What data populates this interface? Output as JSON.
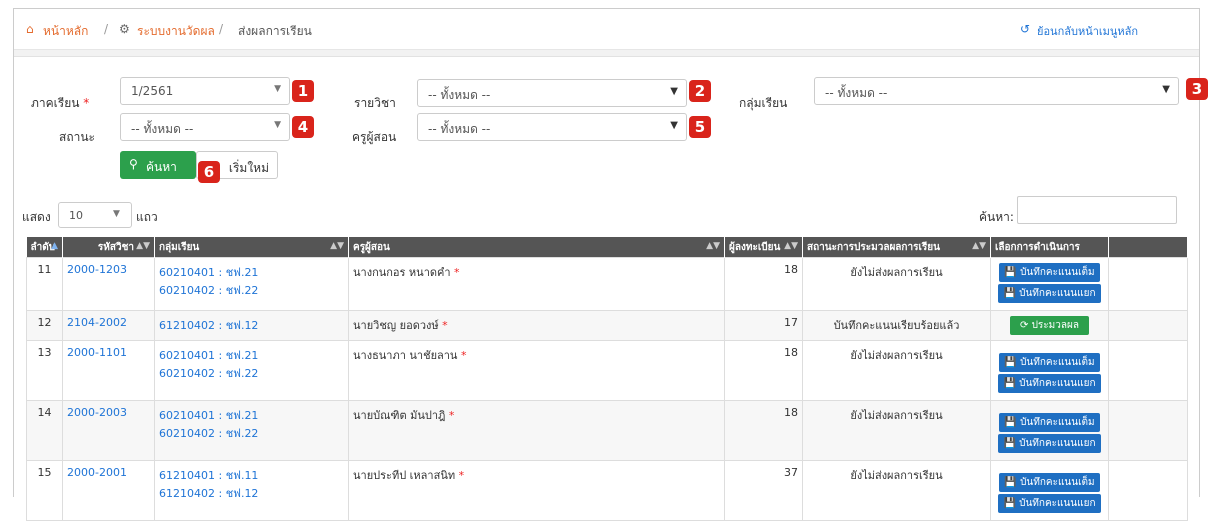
{
  "breadcrumb": {
    "home": "หน้าหลัก",
    "sep1": "/",
    "system": "ระบบงานวัดผล",
    "sep2": "/",
    "current": "ส่งผลการเรียน",
    "back": "ย้อนกลับหน้าเมนูหลัก"
  },
  "filters": {
    "semester_label": "ภาคเรียน",
    "required_mark": "*",
    "semester_value": "1/2561",
    "subject_label": "รายวิชา",
    "subject_value": "-- ทั้งหมด --",
    "group_label": "กลุ่มเรียน",
    "group_value": "-- ทั้งหมด --",
    "status_label": "สถานะ",
    "status_value": "-- ทั้งหมด --",
    "teacher_label": "ครูผู้สอน",
    "teacher_value": "-- ทั้งหมด --",
    "search_button": "ค้นหา",
    "reset_button": "เริ่มใหม่"
  },
  "badges": [
    "1",
    "2",
    "3",
    "4",
    "5",
    "6"
  ],
  "table_controls": {
    "show_label": "แสดง",
    "length_value": "10",
    "rows_label": "แถว",
    "search_label": "ค้นหา:"
  },
  "table": {
    "columns": [
      "ลำดับ",
      "รหัสวิชา",
      "กลุ่มเรียน",
      "ครูผู้สอน",
      "ผู้ลงทะเบียน",
      "สถานะการประมวลผลการเรียน",
      "เลือกการดำเนินการ"
    ],
    "rows": [
      {
        "no": "11",
        "code": "2000-1203",
        "group1": "60210401 : ชฟ.21",
        "group2": "60210402 : ชฟ.22",
        "teacher": "นางกนกอร หนาดคำ",
        "req": "*",
        "count": "18",
        "status": "ยังไม่ส่งผลการเรียน",
        "action1": "บันทึกคะแนนเต็ม",
        "action2": "บันทึกคะแนนแยก"
      },
      {
        "no": "12",
        "code": "2104-2002",
        "group1": "61210402 : ชฟ.12",
        "group2": "",
        "teacher": "นายวิชญ ยอดวงษ์",
        "req": "*",
        "count": "17",
        "status": "บันทึกคะแนนเรียบร้อยแล้ว",
        "action1": "ประมวลผล",
        "action2": ""
      },
      {
        "no": "13",
        "code": "2000-1101",
        "group1": "60210401 : ชฟ.21",
        "group2": "60210402 : ชฟ.22",
        "teacher": "นางธนาภา นาชัยลาน",
        "req": "*",
        "count": "18",
        "status": "ยังไม่ส่งผลการเรียน",
        "action1": "บันทึกคะแนนเต็ม",
        "action2": "บันทึกคะแนนแยก"
      },
      {
        "no": "14",
        "code": "2000-2003",
        "group1": "60210401 : ชฟ.21",
        "group2": "60210402 : ชฟ.22",
        "teacher": "นายบัณฑิต มันปาฎิ",
        "req": "*",
        "count": "18",
        "status": "ยังไม่ส่งผลการเรียน",
        "action1": "บันทึกคะแนนเต็ม",
        "action2": "บันทึกคะแนนแยก"
      },
      {
        "no": "15",
        "code": "2000-2001",
        "group1": "61210401 : ชฟ.11",
        "group2": "61210402 : ชฟ.12",
        "teacher": "นายประทีป เหลาสนิท",
        "req": "*",
        "count": "37",
        "status": "ยังไม่ส่งผลการเรียน",
        "action1": "บันทึกคะแนนเต็ม",
        "action2": "บันทึกคะแนนแยก"
      }
    ]
  }
}
